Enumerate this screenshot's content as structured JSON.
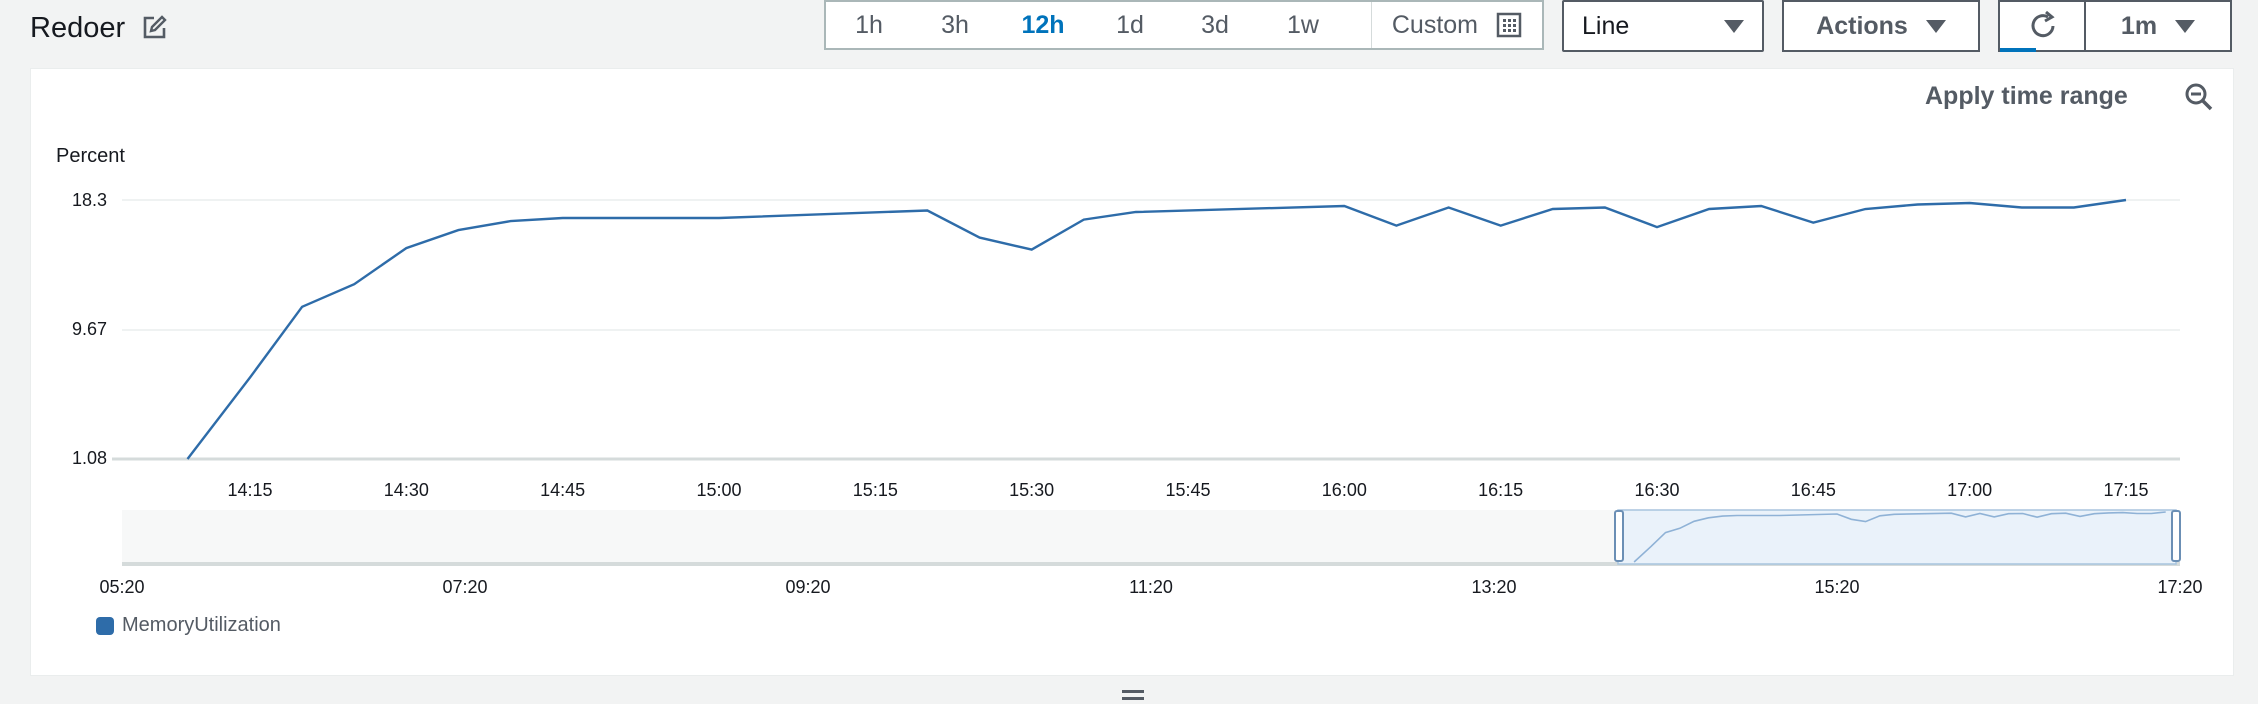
{
  "header": {
    "title": "Redoer"
  },
  "time_ranges": [
    "1h",
    "3h",
    "12h",
    "1d",
    "3d",
    "1w"
  ],
  "active_range": "12h",
  "custom_label": "Custom",
  "graph_type": "Line",
  "actions_label": "Actions",
  "period_label": "1m",
  "apply_label": "Apply time range",
  "legend_label": "MemoryUtilization",
  "colors": {
    "series": "#2e6ca9",
    "accent": "#0073bb"
  },
  "icons": [
    "edit-icon",
    "calendar-icon",
    "refresh-icon",
    "zoom-out-icon",
    "caret-down-icon",
    "drag-handle-icon"
  ],
  "chart_data": {
    "type": "line",
    "ylabel": "Percent",
    "y_ticks": [
      "18.3",
      "9.67",
      "1.08"
    ],
    "ylim": [
      1.08,
      18.3
    ],
    "x_ticks": [
      "14:15",
      "14:30",
      "14:45",
      "15:00",
      "15:15",
      "15:30",
      "15:45",
      "16:00",
      "16:15",
      "16:30",
      "16:45",
      "17:00",
      "17:15"
    ],
    "overview_ticks": [
      "05:20",
      "07:20",
      "09:20",
      "11:20",
      "13:20",
      "15:20",
      "17:20"
    ],
    "series": [
      {
        "name": "MemoryUtilization",
        "points": [
          [
            "14:09",
            1.08
          ],
          [
            "14:15",
            6.5
          ],
          [
            "14:20",
            11.2
          ],
          [
            "14:25",
            12.7
          ],
          [
            "14:30",
            15.1
          ],
          [
            "14:35",
            16.3
          ],
          [
            "14:40",
            16.9
          ],
          [
            "14:45",
            17.1
          ],
          [
            "14:50",
            17.1
          ],
          [
            "15:00",
            17.1
          ],
          [
            "15:20",
            17.6
          ],
          [
            "15:25",
            15.8
          ],
          [
            "15:30",
            15.0
          ],
          [
            "15:35",
            17.0
          ],
          [
            "15:40",
            17.5
          ],
          [
            "16:00",
            17.9
          ],
          [
            "16:05",
            16.6
          ],
          [
            "16:10",
            17.8
          ],
          [
            "16:15",
            16.6
          ],
          [
            "16:20",
            17.7
          ],
          [
            "16:25",
            17.8
          ],
          [
            "16:30",
            16.5
          ],
          [
            "16:35",
            17.7
          ],
          [
            "16:40",
            17.9
          ],
          [
            "16:45",
            16.8
          ],
          [
            "16:50",
            17.7
          ],
          [
            "16:55",
            18.0
          ],
          [
            "17:00",
            18.1
          ],
          [
            "17:05",
            17.8
          ],
          [
            "17:10",
            17.8
          ],
          [
            "17:15",
            18.3
          ]
        ]
      }
    ]
  }
}
